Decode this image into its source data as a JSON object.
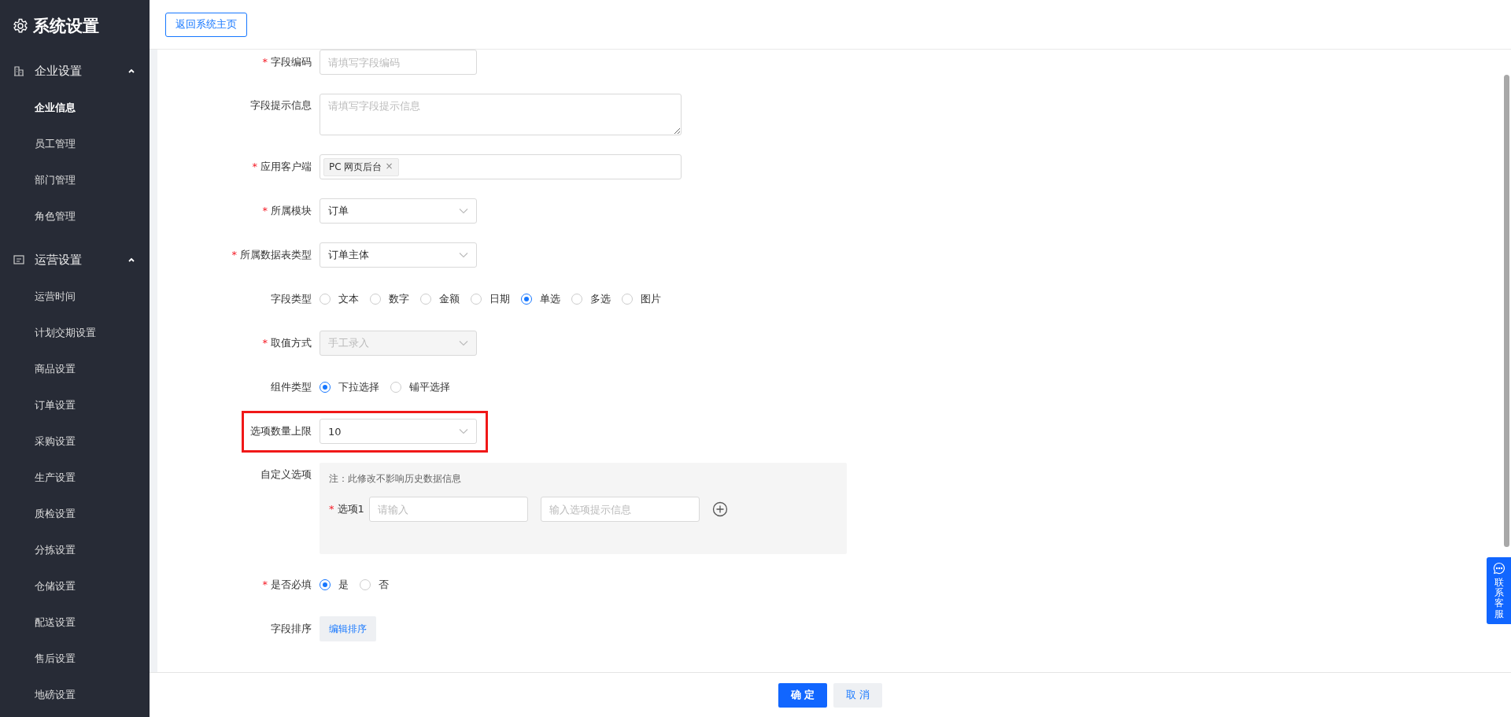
{
  "sidebar": {
    "title": "系统设置",
    "groups": [
      {
        "label": "企业设置",
        "expanded": true,
        "items": [
          {
            "label": "企业信息",
            "selected": true
          },
          {
            "label": "员工管理",
            "selected": false
          },
          {
            "label": "部门管理",
            "selected": false
          },
          {
            "label": "角色管理",
            "selected": false
          }
        ]
      },
      {
        "label": "运营设置",
        "expanded": true,
        "items": [
          {
            "label": "运营时间",
            "selected": false
          },
          {
            "label": "计划交期设置",
            "selected": false
          },
          {
            "label": "商品设置",
            "selected": false
          },
          {
            "label": "订单设置",
            "selected": false
          },
          {
            "label": "采购设置",
            "selected": false
          },
          {
            "label": "生产设置",
            "selected": false
          },
          {
            "label": "质检设置",
            "selected": false
          },
          {
            "label": "分拣设置",
            "selected": false
          },
          {
            "label": "仓储设置",
            "selected": false
          },
          {
            "label": "配送设置",
            "selected": false
          },
          {
            "label": "售后设置",
            "selected": false
          },
          {
            "label": "地磅设置",
            "selected": false
          }
        ]
      }
    ]
  },
  "topbar": {
    "back_button": "返回系统主页"
  },
  "form": [
    {
      "kind": "input",
      "label": "字段编码",
      "required_mark": "*",
      "highlighted": false,
      "placeholder": "请填写字段编码"
    },
    {
      "kind": "textarea",
      "label": "字段提示信息",
      "highlighted": false,
      "placeholder": "请填写字段提示信息"
    },
    {
      "kind": "tags",
      "label": "应用客户端",
      "required_mark": "*",
      "highlighted": false,
      "tags": [
        {
          "text": "PC 网页后台",
          "remove": "×"
        }
      ]
    },
    {
      "kind": "select",
      "label": "所属模块",
      "required_mark": "*",
      "highlighted": false,
      "disabled": false,
      "value": "订单"
    },
    {
      "kind": "select",
      "label": "所属数据表类型",
      "required_mark": "*",
      "highlighted": false,
      "disabled": false,
      "value": "订单主体"
    },
    {
      "kind": "radio",
      "label": "字段类型",
      "highlighted": false,
      "options": [
        {
          "label": "文本",
          "selected": false
        },
        {
          "label": "数字",
          "selected": false
        },
        {
          "label": "金额",
          "selected": false
        },
        {
          "label": "日期",
          "selected": false
        },
        {
          "label": "单选",
          "selected": true
        },
        {
          "label": "多选",
          "selected": false
        },
        {
          "label": "图片",
          "selected": false
        }
      ]
    },
    {
      "kind": "select",
      "label": "取值方式",
      "required_mark": "*",
      "highlighted": false,
      "disabled": true,
      "value": "手工录入"
    },
    {
      "kind": "radio",
      "label": "组件类型",
      "highlighted": false,
      "options": [
        {
          "label": "下拉选择",
          "selected": true
        },
        {
          "label": "铺平选择",
          "selected": false
        }
      ]
    },
    {
      "kind": "select",
      "label": "选项数量上限",
      "highlighted": true,
      "disabled": false,
      "value": "10"
    },
    {
      "kind": "options",
      "label": "自定义选项",
      "highlighted": false,
      "note": "注：此修改不影响历史数据信息",
      "options": [
        {
          "label": "选项1",
          "required_mark": "*",
          "placeholder": "请输入",
          "hint_placeholder": "输入选项提示信息"
        }
      ]
    },
    {
      "kind": "radio",
      "label": "是否必填",
      "required_mark": "*",
      "highlighted": false,
      "options": [
        {
          "label": "是",
          "selected": true
        },
        {
          "label": "否",
          "selected": false
        }
      ]
    },
    {
      "kind": "button",
      "label": "字段排序",
      "highlighted": false,
      "button": "编辑排序"
    }
  ],
  "footer": {
    "confirm": "确 定",
    "cancel": "取 消"
  },
  "contact": {
    "label": "联系客服"
  }
}
